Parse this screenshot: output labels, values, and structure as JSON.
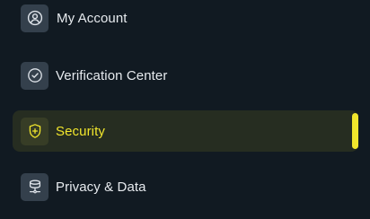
{
  "menu": {
    "items": [
      {
        "label": "My Account",
        "icon": "user-circle-icon",
        "active": false
      },
      {
        "label": "Verification Center",
        "icon": "check-circle-icon",
        "active": false
      },
      {
        "label": "Security",
        "icon": "shield-plus-icon",
        "active": true
      },
      {
        "label": "Privacy & Data",
        "icon": "database-icon",
        "active": false
      }
    ]
  },
  "colors": {
    "background": "#111a22",
    "icon_bg": "#34404c",
    "active_bg": "#262d21",
    "accent": "#f1e62c",
    "text": "#e6eaee"
  }
}
